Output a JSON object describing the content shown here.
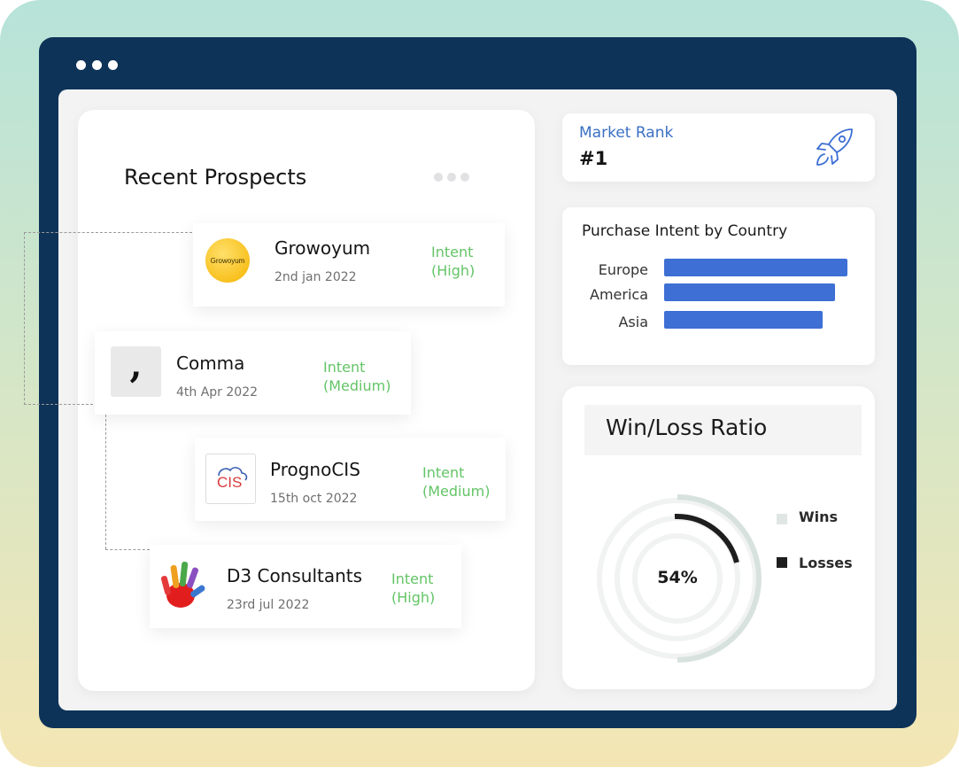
{
  "prospects": {
    "title": "Recent Prospects",
    "items": [
      {
        "name": "Growoyum",
        "date": "2nd jan 2022",
        "intent_label": "Intent",
        "intent_level": "(High)",
        "logo_text": "Growoyum"
      },
      {
        "name": "Comma",
        "date": "4th Apr 2022",
        "intent_label": "Intent",
        "intent_level": "(Medium)",
        "logo_text": ","
      },
      {
        "name": "PrognoCIS",
        "date": "15th oct 2022",
        "intent_label": "Intent",
        "intent_level": "(Medium)",
        "logo_text": "CIS"
      },
      {
        "name": "D3 Consultants",
        "date": "23rd jul 2022",
        "intent_label": "Intent",
        "intent_level": "(High)"
      }
    ]
  },
  "market_rank": {
    "label": "Market Rank",
    "value": "#1",
    "icon": "rocket-icon"
  },
  "purchase_intent": {
    "title": "Purchase Intent by Country",
    "chart_data": {
      "type": "bar",
      "categories": [
        "Europe",
        "America",
        "Asia"
      ],
      "values": [
        207,
        193,
        179
      ]
    }
  },
  "win_loss": {
    "title": "Win/Loss Ratio",
    "percent_label": "54%",
    "legend": [
      {
        "label": "Wins",
        "color": "#dfe6e3"
      },
      {
        "label": "Losses",
        "color": "#1e1e1e"
      }
    ]
  },
  "colors": {
    "accent": "#3d6fd4",
    "intent": "#63c466",
    "frame": "#0e3358"
  }
}
